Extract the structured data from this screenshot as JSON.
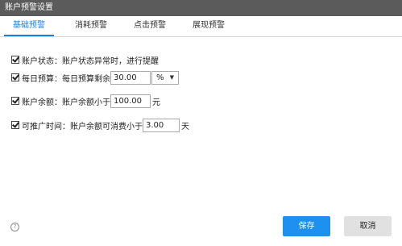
{
  "window": {
    "title": "账户预警设置"
  },
  "tabs": [
    {
      "label": "基础预警",
      "active": true
    },
    {
      "label": "消耗预警",
      "active": false
    },
    {
      "label": "点击预警",
      "active": false
    },
    {
      "label": "展现预警",
      "active": false
    }
  ],
  "rows": {
    "account_status": {
      "checked": true,
      "label": "账户状态：账户状态异常时，进行提醒"
    },
    "daily_budget": {
      "checked": true,
      "label": "每日预算：每日预算剩余",
      "value": "30.00",
      "unit_select": "%"
    },
    "account_balance": {
      "checked": true,
      "label": "账户余额：账户余额小于",
      "value": "100.00",
      "unit": "元"
    },
    "promo_time": {
      "checked": true,
      "label": "可推广时间：账户余额可消费小于",
      "value": "3.00",
      "unit": "天"
    }
  },
  "footer": {
    "help": "?",
    "save_label": "保存",
    "cancel_label": "取消"
  },
  "colors": {
    "titlebar": "#5b5b5b",
    "accent": "#1c7fd9",
    "save_button": "#1e90ef",
    "cancel_button": "#e1e1e1"
  }
}
